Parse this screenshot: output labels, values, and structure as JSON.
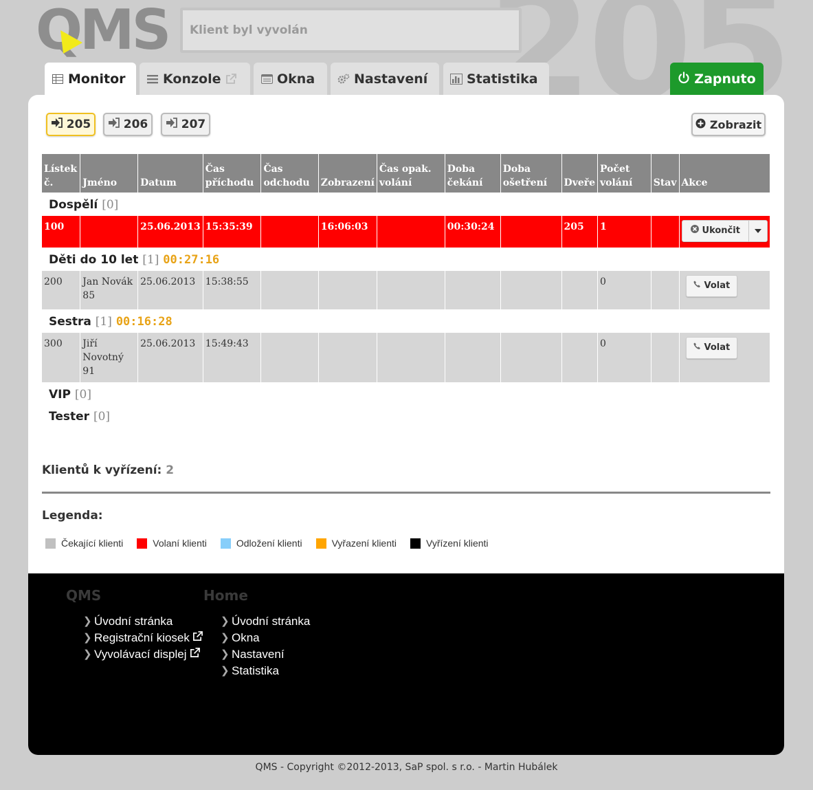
{
  "header": {
    "logo_text": "QMS",
    "background_number": "205",
    "message": "Klient byl vyvolán"
  },
  "tabs": [
    {
      "label": "Monitor",
      "icon": "table-icon",
      "active": true
    },
    {
      "label": "Konzole",
      "icon": "list-icon",
      "external": true
    },
    {
      "label": "Okna",
      "icon": "window-icon"
    },
    {
      "label": "Nastavení",
      "icon": "cogs-icon"
    },
    {
      "label": "Statistika",
      "icon": "bar-chart-icon"
    }
  ],
  "status_tab": {
    "label": "Zapnuto",
    "icon": "power-icon",
    "color": "#1d9a2b"
  },
  "windows": [
    {
      "label": "205",
      "active": true
    },
    {
      "label": "206"
    },
    {
      "label": "207"
    }
  ],
  "show_button": "Zobrazit",
  "table": {
    "headers": [
      "Lístek č.",
      "Jméno",
      "Datum",
      "Čas příchodu",
      "Čas odchodu",
      "Zobrazení",
      "Čas opak. volání",
      "Doba čekání",
      "Doba ošetření",
      "Dveře",
      "Počet volání",
      "Stav",
      "Akce"
    ],
    "groups": [
      {
        "name": "Dospělí",
        "count": "[0]",
        "time": "",
        "rows": [
          {
            "status": "called",
            "cells": [
              "100",
              "",
              "25.06.2013",
              "15:35:39",
              "",
              "16:06:03",
              "",
              "00:30:24",
              "",
              "205",
              "1",
              ""
            ],
            "action": "Ukončit"
          }
        ]
      },
      {
        "name": "Děti do 10 let",
        "count": "[1]",
        "time": "00:27:16",
        "rows": [
          {
            "status": "waiting",
            "cells": [
              "200",
              "Jan Novák 85",
              "25.06.2013",
              "15:38:55",
              "",
              "",
              "",
              "",
              "",
              "",
              "0",
              ""
            ],
            "action": "Volat"
          }
        ]
      },
      {
        "name": "Sestra",
        "count": "[1]",
        "time": "00:16:28",
        "rows": [
          {
            "status": "waiting",
            "cells": [
              "300",
              "Jiří Novotný 91",
              "25.06.2013",
              "15:49:43",
              "",
              "",
              "",
              "",
              "",
              "",
              "0",
              ""
            ],
            "action": "Volat"
          }
        ]
      },
      {
        "name": "VIP",
        "count": "[0]",
        "time": "",
        "rows": []
      },
      {
        "name": "Tester",
        "count": "[0]",
        "time": "",
        "rows": []
      }
    ]
  },
  "pending": {
    "label": "Klientů k vyřízení:",
    "value": "2"
  },
  "legend": {
    "title": "Legenda:",
    "items": [
      {
        "label": "Čekající klienti",
        "color": "#c0c0c0"
      },
      {
        "label": "Volaní klienti",
        "color": "#ff0000"
      },
      {
        "label": "Odložení klienti",
        "color": "#87cefa"
      },
      {
        "label": "Vyřazení klienti",
        "color": "#ffa500"
      },
      {
        "label": "Vyřízení klienti",
        "color": "#000000"
      }
    ]
  },
  "footer": {
    "columns": [
      {
        "title": "QMS",
        "links": [
          {
            "label": "Úvodní stránka"
          },
          {
            "label": "Registrační kiosek",
            "external": true
          },
          {
            "label": "Vyvolávací displej",
            "external": true
          }
        ]
      },
      {
        "title": "Home",
        "links": [
          {
            "label": "Úvodní stránka"
          },
          {
            "label": "Okna"
          },
          {
            "label": "Nastavení"
          },
          {
            "label": "Statistika"
          }
        ]
      }
    ],
    "copyright": "QMS - Copyright ©2012-2013, SaP spol. s r.o. - Martin Hubálek"
  }
}
